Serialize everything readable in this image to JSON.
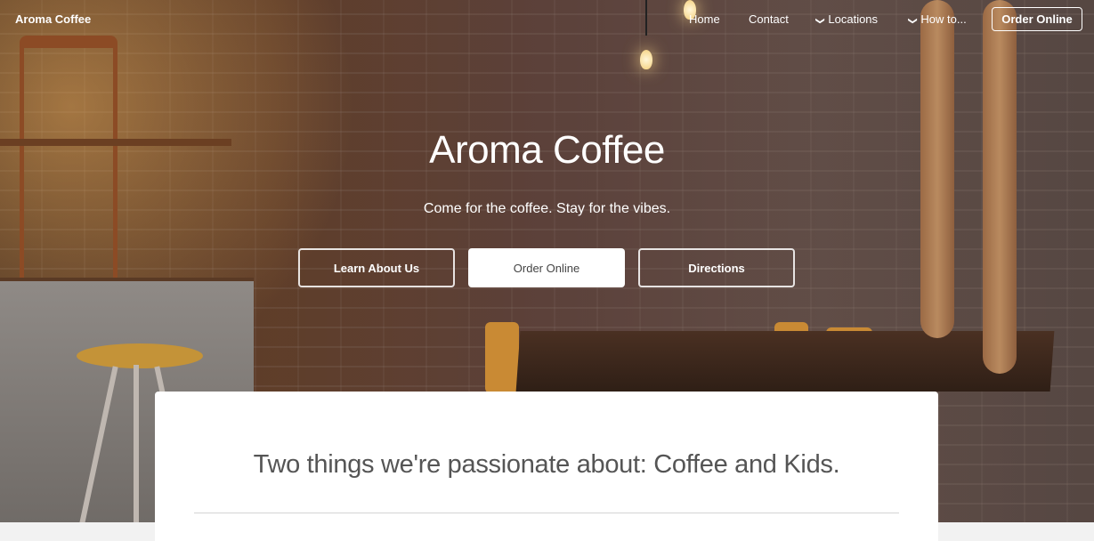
{
  "nav": {
    "brand": "Aroma Coffee",
    "items": [
      {
        "label": "Home",
        "has_dropdown": false
      },
      {
        "label": "Contact",
        "has_dropdown": false
      },
      {
        "label": "Locations",
        "has_dropdown": true
      },
      {
        "label": "How to...",
        "has_dropdown": true
      }
    ],
    "cta_label": "Order Online",
    "chevron_glyph": "❯"
  },
  "hero": {
    "title": "Aroma Coffee",
    "subtitle": "Come for the coffee. Stay for the vibes.",
    "buttons": [
      {
        "label": "Learn About Us",
        "style": "outline"
      },
      {
        "label": "Order Online",
        "style": "solid"
      },
      {
        "label": "Directions",
        "style": "outline"
      }
    ]
  },
  "intro": {
    "heading": "Two things we're passionate about: Coffee and Kids."
  },
  "colors": {
    "text_light": "#ffffff",
    "heading_gray": "#555555",
    "page_bg": "#f2f2f2"
  }
}
